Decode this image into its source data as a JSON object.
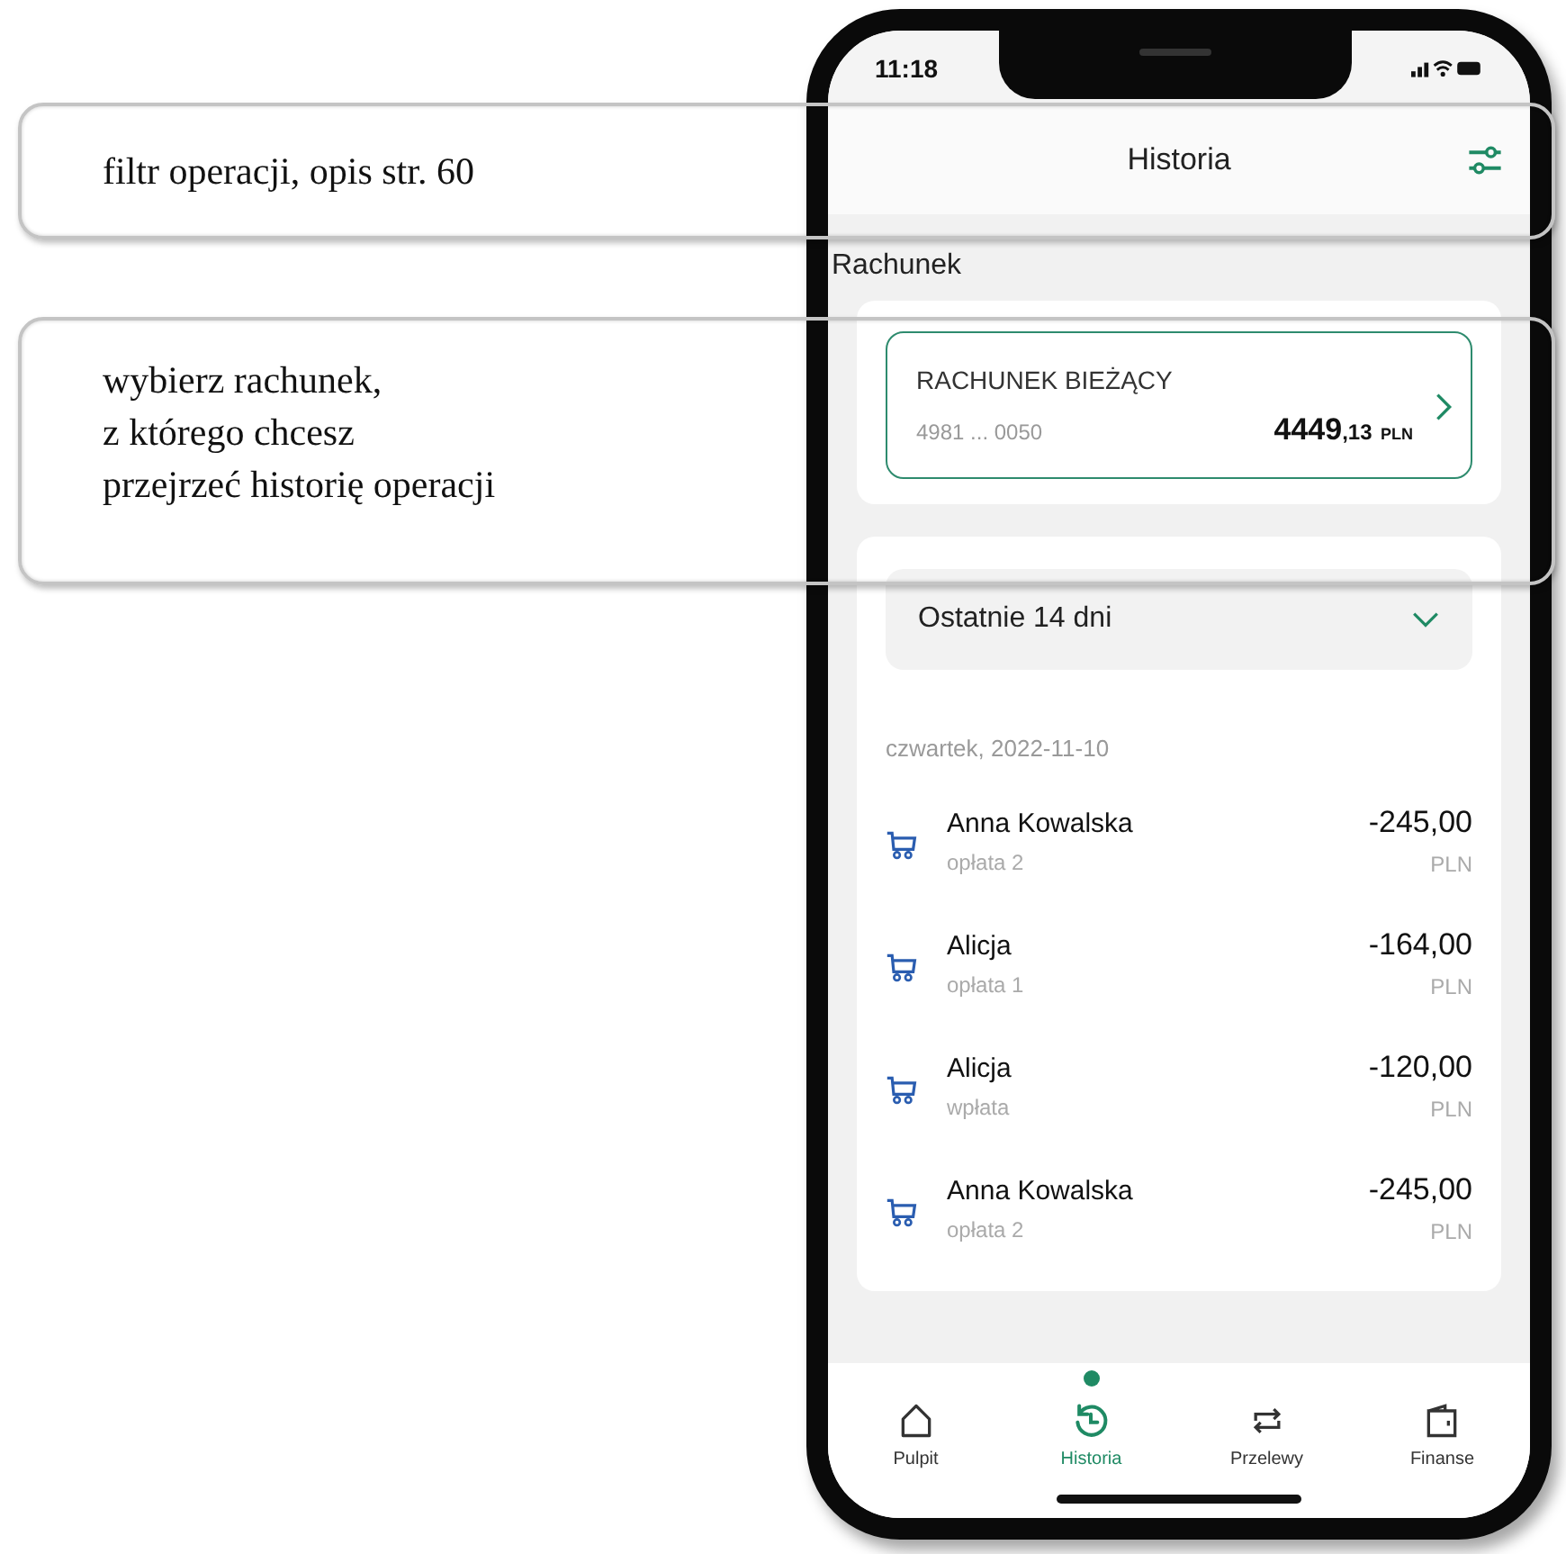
{
  "callouts": [
    {
      "text": "filtr operacji, opis str. 60"
    },
    {
      "text": "wybierz rachunek,\nz którego chcesz\nprzejrzeć historię operacji"
    }
  ],
  "status_bar": {
    "time": "11:18"
  },
  "header": {
    "title": "Historia"
  },
  "section_label": "Rachunek",
  "account": {
    "name": "RACHUNEK BIEŻĄCY",
    "number": "4981 ... 0050",
    "amount": "4449",
    "fraction": ",13",
    "currency": "PLN"
  },
  "period": {
    "value": "Ostatnie 14 dni"
  },
  "date": "czwartek, 2022-11-10",
  "transactions": [
    {
      "name": "Anna Kowalska",
      "description": "opłata 2",
      "amount": "-245,00",
      "currency": "PLN"
    },
    {
      "name": "Alicja",
      "description": "opłata 1",
      "amount": "-164,00",
      "currency": "PLN"
    },
    {
      "name": "Alicja",
      "description": "wpłata",
      "amount": "-120,00",
      "currency": "PLN"
    },
    {
      "name": "Anna Kowalska",
      "description": "opłata 2",
      "amount": "-245,00",
      "currency": "PLN"
    }
  ],
  "nav": [
    {
      "kind": "home",
      "label": "Pulpit",
      "selected": false
    },
    {
      "kind": "history",
      "label": "Historia",
      "selected": true
    },
    {
      "kind": "transfers",
      "label": "Przelewy",
      "selected": false
    },
    {
      "kind": "finance",
      "label": "Finanse",
      "selected": false
    }
  ]
}
